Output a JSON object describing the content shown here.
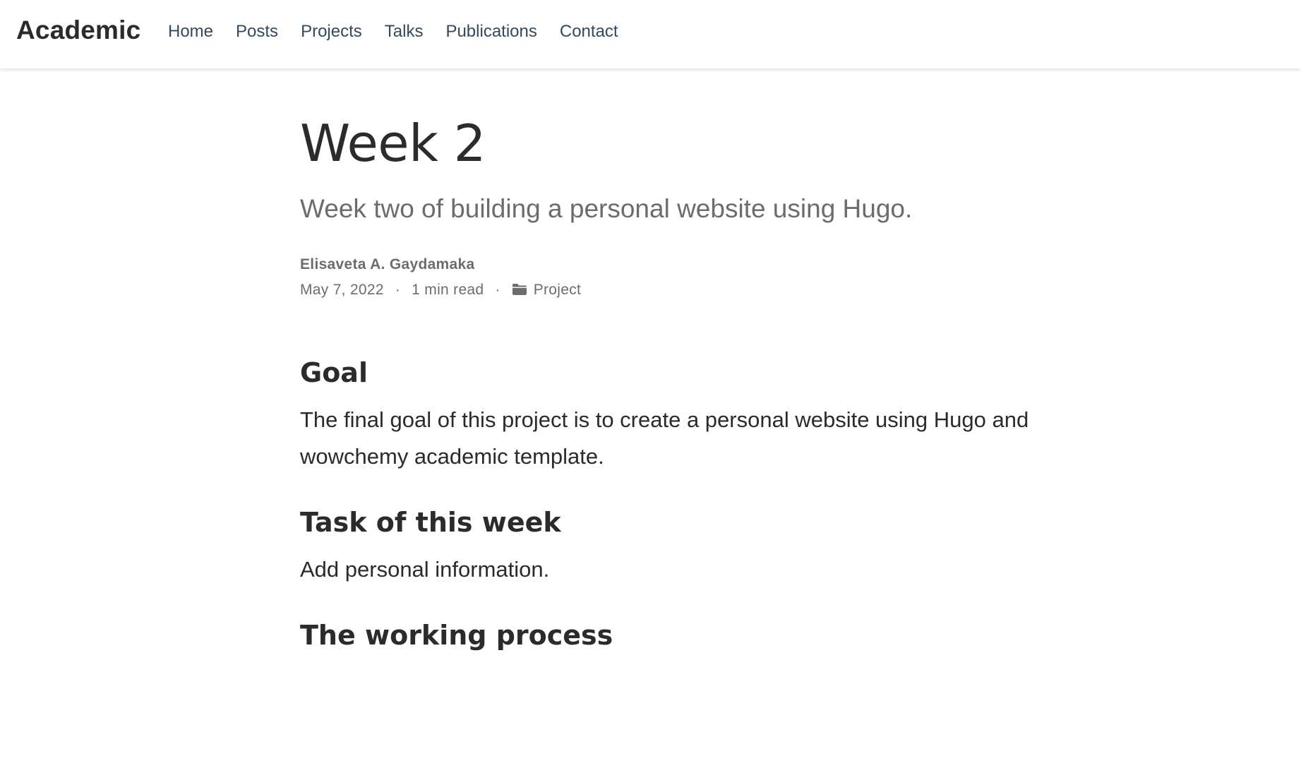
{
  "navbar": {
    "brand": "Academic",
    "links": [
      "Home",
      "Posts",
      "Projects",
      "Talks",
      "Publications",
      "Contact"
    ]
  },
  "article": {
    "title": "Week 2",
    "subtitle": "Week two of building a personal website using Hugo.",
    "author": "Elisaveta A. Gaydamaka",
    "date": "May 7, 2022",
    "separator": "·",
    "reading_time": "1 min read",
    "category": "Project",
    "category_icon": "folder-icon",
    "sections": [
      {
        "heading": "Goal",
        "body": "The final goal of this project is to create a personal website using Hugo and wowchemy academic template."
      },
      {
        "heading": "Task of this week",
        "body": "Add personal information."
      },
      {
        "heading": "The working process",
        "body": ""
      }
    ]
  },
  "colors": {
    "text": "#2b2b2b",
    "muted": "#6c6c6c",
    "nav_link": "#34495e",
    "background": "#ffffff"
  }
}
